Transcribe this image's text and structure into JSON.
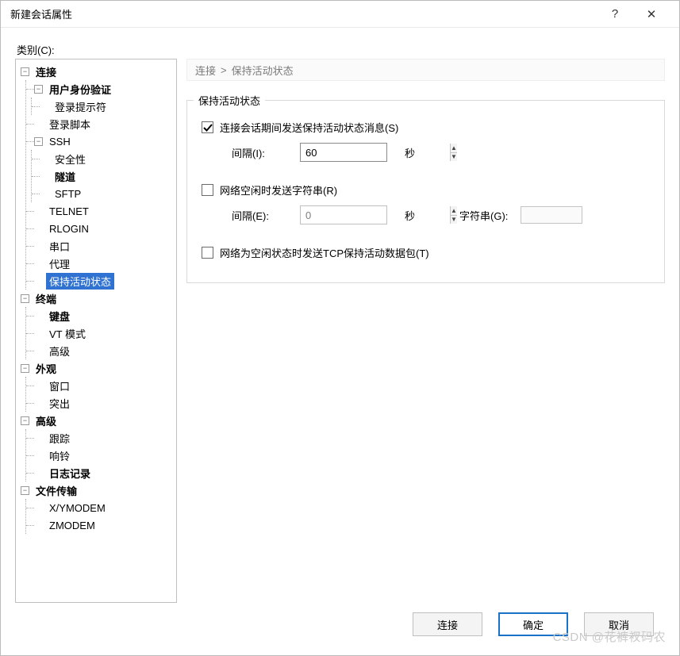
{
  "window": {
    "title": "新建会话属性"
  },
  "titlebar_icons": {
    "help": "?",
    "close": "✕"
  },
  "category_label": "类别(C):",
  "tree": {
    "n0": {
      "label": "连接",
      "bold": true
    },
    "n1": {
      "label": "用户身份验证",
      "bold": true
    },
    "n2": {
      "label": "登录提示符"
    },
    "n3": {
      "label": "登录脚本"
    },
    "n4": {
      "label": "SSH"
    },
    "n5": {
      "label": "安全性"
    },
    "n6": {
      "label": "隧道",
      "bold": true
    },
    "n7": {
      "label": "SFTP"
    },
    "n8": {
      "label": "TELNET"
    },
    "n9": {
      "label": "RLOGIN"
    },
    "n10": {
      "label": "串口"
    },
    "n11": {
      "label": "代理"
    },
    "n12": {
      "label": "保持活动状态",
      "selected": true
    },
    "n13": {
      "label": "终端",
      "bold": true
    },
    "n14": {
      "label": "键盘",
      "bold": true
    },
    "n15": {
      "label": "VT 模式"
    },
    "n16": {
      "label": "高级"
    },
    "n17": {
      "label": "外观",
      "bold": true
    },
    "n18": {
      "label": "窗口"
    },
    "n19": {
      "label": "突出"
    },
    "n20": {
      "label": "高级",
      "bold": true
    },
    "n21": {
      "label": "跟踪"
    },
    "n22": {
      "label": "响铃"
    },
    "n23": {
      "label": "日志记录",
      "bold": true
    },
    "n24": {
      "label": "文件传输",
      "bold": true
    },
    "n25": {
      "label": "X/YMODEM"
    },
    "n26": {
      "label": "ZMODEM"
    }
  },
  "breadcrumb": {
    "part1": "连接",
    "sep": ">",
    "part2": "保持活动状态"
  },
  "group": {
    "title": "保持活动状态",
    "chk_session": "连接会话期间发送保持活动状态消息(S)",
    "interval1_label": "间隔(I):",
    "interval1_value": "60",
    "sec_unit": "秒",
    "chk_idle": "网络空闲时发送字符串(R)",
    "interval2_label": "间隔(E):",
    "interval2_value": "0",
    "string_label": "字符串(G):",
    "chk_tcp": "网络为空闲状态时发送TCP保持活动数据包(T)"
  },
  "buttons": {
    "connect": "连接",
    "ok": "确定",
    "cancel": "取消"
  },
  "watermark": "CSDN @花裤衩码农"
}
